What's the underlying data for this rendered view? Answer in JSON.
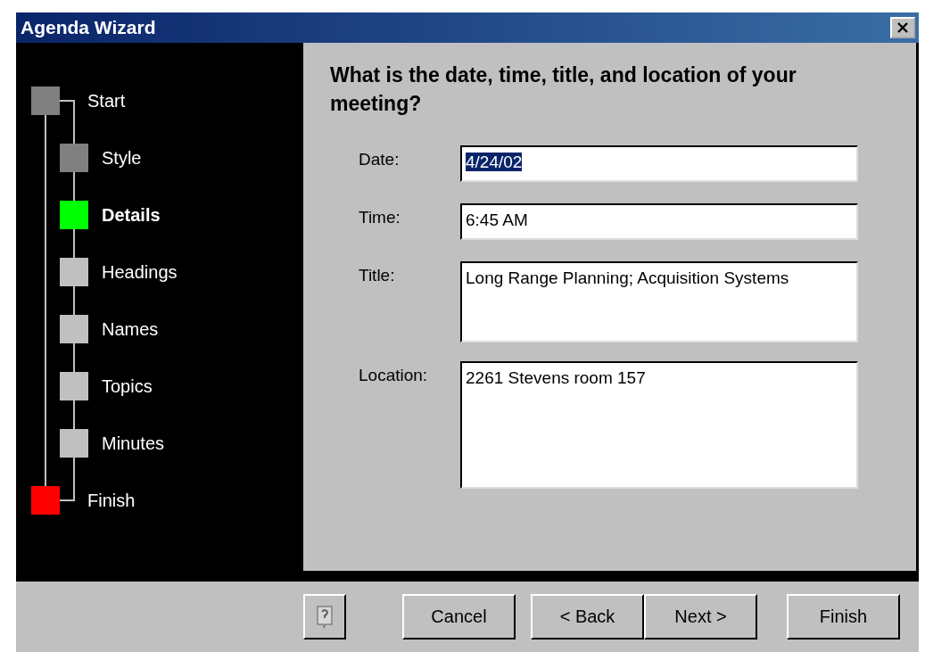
{
  "window": {
    "title": "Agenda Wizard"
  },
  "steps": [
    {
      "label": "Start",
      "kind": "main",
      "color": "#808080",
      "selected": false
    },
    {
      "label": "Style",
      "kind": "sub",
      "color": "#808080",
      "selected": false
    },
    {
      "label": "Details",
      "kind": "sub",
      "color": "#00ff00",
      "selected": true
    },
    {
      "label": "Headings",
      "kind": "sub",
      "color": "#c0c0c0",
      "selected": false
    },
    {
      "label": "Names",
      "kind": "sub",
      "color": "#c0c0c0",
      "selected": false
    },
    {
      "label": "Topics",
      "kind": "sub",
      "color": "#c0c0c0",
      "selected": false
    },
    {
      "label": "Minutes",
      "kind": "sub",
      "color": "#c0c0c0",
      "selected": false
    },
    {
      "label": "Finish",
      "kind": "main",
      "color": "#ff0000",
      "selected": false
    }
  ],
  "question": "What is the date, time, title, and location of your meeting?",
  "fields": [
    {
      "label": "Date:",
      "value": "4/24/02",
      "kind": "single",
      "text_selected": true
    },
    {
      "label": "Time:",
      "value": "6:45 AM",
      "kind": "single",
      "text_selected": false
    },
    {
      "label": "Title:",
      "value": "Long Range Planning; Acquisition Systems",
      "kind": "title",
      "text_selected": false
    },
    {
      "label": "Location:",
      "value": "2261 Stevens room 157",
      "kind": "location",
      "text_selected": false
    }
  ],
  "buttons": [
    "Cancel",
    "< Back",
    "Next >",
    "Finish"
  ]
}
